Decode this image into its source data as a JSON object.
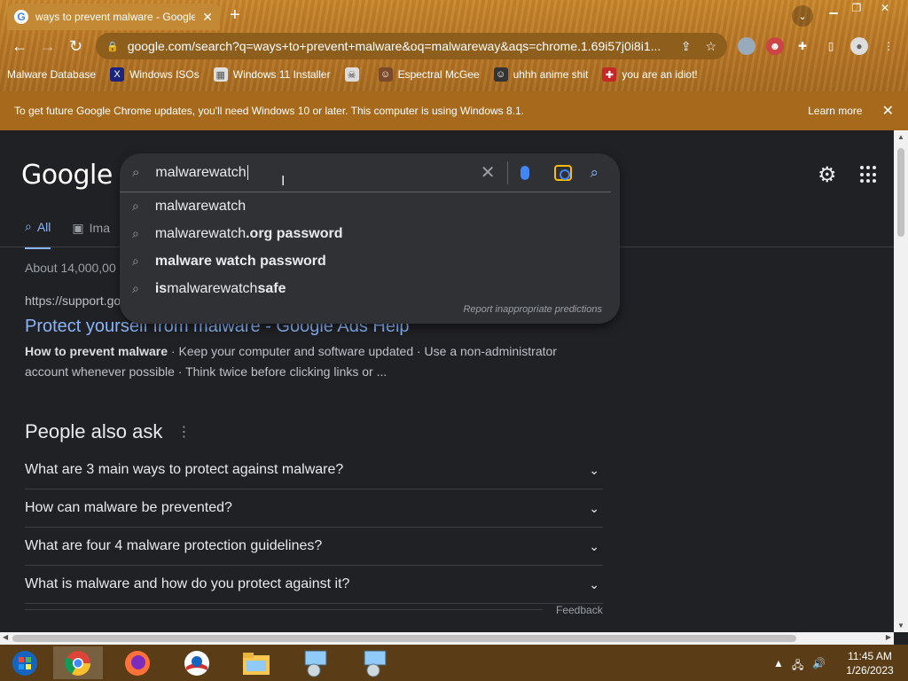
{
  "browser": {
    "tab_title": "ways to prevent malware - Google",
    "url_host": "google.com",
    "url_rest": "/search?q=ways+to+prevent+malware&oq=malwareway&aqs=chrome.1.69i57j0i8i1...",
    "bookmarks": [
      {
        "label": "Malware Database",
        "icon": "folder-icon"
      },
      {
        "label": "Windows ISOs",
        "icon": "x-icon"
      },
      {
        "label": "Windows 11 Installer",
        "icon": "image-icon"
      },
      {
        "label": "",
        "icon": "skull-icon"
      },
      {
        "label": "Espectral McGee",
        "icon": "face-icon"
      },
      {
        "label": "uhhh anime shit",
        "icon": "face-icon"
      },
      {
        "label": "you are an idiot!",
        "icon": "flag-icon"
      }
    ]
  },
  "infobar": {
    "message": "To get future Google Chrome updates, you'll need Windows 10 or later. This computer is using Windows 8.1.",
    "learn_more": "Learn more"
  },
  "google": {
    "logo": "Google",
    "query": "malwarewatch",
    "suggestions": [
      {
        "prefix": "",
        "typed": "malwarewatch",
        "suffix": ""
      },
      {
        "prefix": "",
        "typed": "malwarewatch",
        "suffix": ".org password"
      },
      {
        "prefix": "malware watch password",
        "typed": "",
        "suffix": ""
      },
      {
        "prefix": "is ",
        "typed": "malwarewatch",
        "suffix": " safe"
      }
    ],
    "report_link": "Report inappropriate predictions",
    "tabs": [
      {
        "label": "All",
        "active": true
      },
      {
        "label": "Ima",
        "active": false
      }
    ],
    "stats": "About 14,000,00",
    "result": {
      "cite": "https://support.go",
      "title": "Protect yourself from malware - Google Ads Help",
      "snippet_bold": "How to prevent malware",
      "snippet": " · Keep your computer and software updated · Use a non-administrator account whenever possible · Think twice before clicking links or ..."
    },
    "people_also_ask": {
      "heading": "People also ask",
      "questions": [
        "What are 3 main ways to protect against malware?",
        "How can malware be prevented?",
        "What are four 4 malware protection guidelines?",
        "What is malware and how do you protect against it?"
      ]
    },
    "feedback": "Feedback"
  },
  "taskbar": {
    "time": "11:45 AM",
    "date": "1/26/2023"
  }
}
